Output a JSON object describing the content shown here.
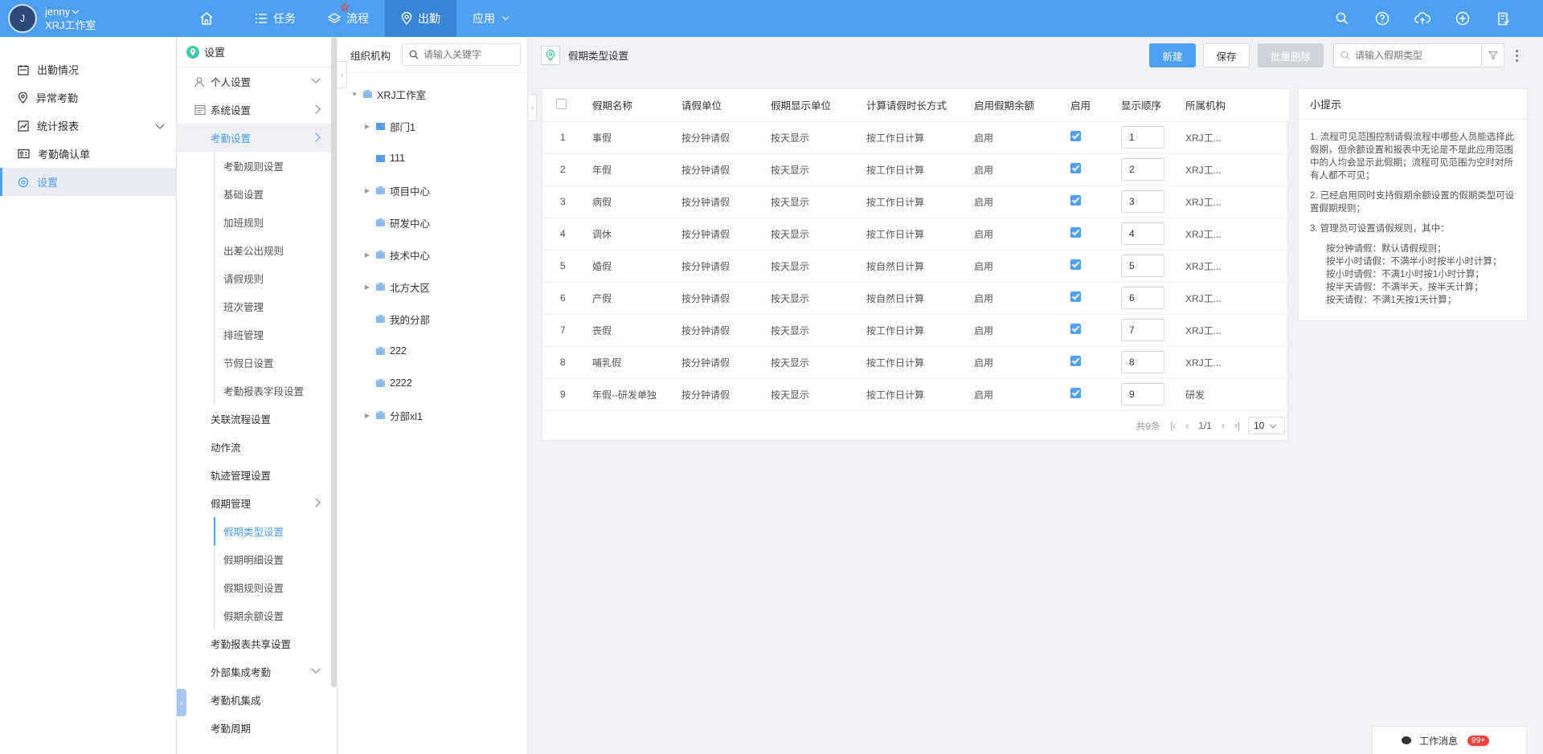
{
  "user": {
    "initial": "J",
    "name": "jenny",
    "studio": "XRJ工作室"
  },
  "nav": [
    {
      "label": "任务"
    },
    {
      "label": "流程"
    },
    {
      "label": "出勤"
    },
    {
      "label": "应用"
    }
  ],
  "sidebar1": [
    {
      "label": "出勤情况"
    },
    {
      "label": "异常考勤"
    },
    {
      "label": "统计报表"
    },
    {
      "label": "考勤确认单"
    },
    {
      "label": "设置"
    }
  ],
  "sidebar2": {
    "header": "设置",
    "personal": "个人设置",
    "system": "系统设置",
    "attendance": "考勤设置",
    "attendance_sub": [
      "考勤规则设置",
      "基础设置",
      "加班规则",
      "出差公出规则",
      "请假规则",
      "班次管理",
      "排班管理",
      "节假日设置",
      "考勤报表字段设置"
    ],
    "flow": "关联流程设置",
    "action": "动作流",
    "track": "轨迹管理设置",
    "holiday": "假期管理",
    "holiday_sub": [
      "假期类型设置",
      "假期明细设置",
      "假期规则设置",
      "假期余额设置"
    ],
    "share": "考勤报表共享设置",
    "external": "外部集成考勤",
    "machine": "考勤机集成",
    "period": "考勤周期"
  },
  "org": {
    "label": "组织机构",
    "search_placeholder": "请输入关键字",
    "root": "XRJ工作室",
    "children": [
      "部门1",
      "111",
      "项目中心",
      "研发中心",
      "技术中心",
      "北方大区",
      "我的分部",
      "222",
      "2222",
      "分部xl1"
    ]
  },
  "main": {
    "title": "假期类型设置",
    "btn_new": "新建",
    "btn_save": "保存",
    "btn_batch_delete": "批量删除",
    "type_search_placeholder": "请输入假期类型"
  },
  "table": {
    "headers": [
      "假期名称",
      "请假单位",
      "假期显示单位",
      "计算请假时长方式",
      "启用假期余额",
      "启用",
      "显示顺序",
      "所属机构"
    ],
    "rows": [
      {
        "no": "1",
        "name": "事假",
        "unit": "按分钟请假",
        "show": "按天显示",
        "calc": "按工作日计算",
        "balance": "启用",
        "order": "1",
        "org": "XRJ工..."
      },
      {
        "no": "2",
        "name": "年假",
        "unit": "按分钟请假",
        "show": "按天显示",
        "calc": "按工作日计算",
        "balance": "启用",
        "order": "2",
        "org": "XRJ工..."
      },
      {
        "no": "3",
        "name": "病假",
        "unit": "按分钟请假",
        "show": "按天显示",
        "calc": "按工作日计算",
        "balance": "启用",
        "order": "3",
        "org": "XRJ工..."
      },
      {
        "no": "4",
        "name": "调休",
        "unit": "按分钟请假",
        "show": "按天显示",
        "calc": "按工作日计算",
        "balance": "启用",
        "order": "4",
        "org": "XRJ工..."
      },
      {
        "no": "5",
        "name": "婚假",
        "unit": "按分钟请假",
        "show": "按天显示",
        "calc": "按自然日计算",
        "balance": "启用",
        "order": "5",
        "org": "XRJ工..."
      },
      {
        "no": "6",
        "name": "产假",
        "unit": "按分钟请假",
        "show": "按天显示",
        "calc": "按自然日计算",
        "balance": "启用",
        "order": "6",
        "org": "XRJ工..."
      },
      {
        "no": "7",
        "name": "丧假",
        "unit": "按分钟请假",
        "show": "按天显示",
        "calc": "按工作日计算",
        "balance": "启用",
        "order": "7",
        "org": "XRJ工..."
      },
      {
        "no": "8",
        "name": "哺乳假",
        "unit": "按分钟请假",
        "show": "按天显示",
        "calc": "按工作日计算",
        "balance": "启用",
        "order": "8",
        "org": "XRJ工..."
      },
      {
        "no": "9",
        "name": "年假--研发单独",
        "unit": "按分钟请假",
        "show": "按天显示",
        "calc": "按工作日计算",
        "balance": "启用",
        "order": "9",
        "org": "研发"
      }
    ]
  },
  "pager": {
    "total": "共9条",
    "page": "1/1",
    "size": "10"
  },
  "tips": {
    "title": "小提示",
    "p1": "1. 流程可见范围控制请假流程中哪些人员能选择此假期，但余额设置和报表中无论是不是此应用范围中的人均会显示此假期；流程可见范围为空时对所有人都不可见；",
    "p2": "2. 已经启用同时支持假期余额设置的假期类型可设置假期规则；",
    "p3": "3. 管理员可设置请假规则，其中：",
    "rules": [
      "按分钟请假：默认请假规则；",
      "按半小时请假：不满半小时按半小时计算；",
      "按小时请假：不满1小时按1小时计算；",
      "按半天请假：不满半天，按半天计算；",
      "按天请假：不满1天按1天计算；"
    ]
  },
  "messages": {
    "label": "工作消息",
    "badge": "99+"
  },
  "colors": {
    "primary": "#4d9ff0",
    "accent": "#3fc7a6",
    "badge": "#f0433f"
  }
}
